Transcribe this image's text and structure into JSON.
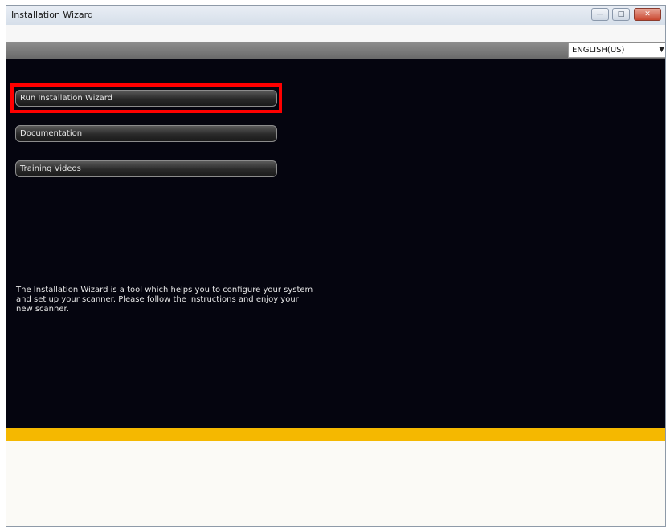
{
  "window": {
    "title": "Installation Wizard",
    "controls": {
      "minimize_glyph": "—",
      "maximize_glyph": "□",
      "close_glyph": "✕"
    }
  },
  "language": {
    "selected": "ENGLISH(US)",
    "arrow": "▼"
  },
  "menu": {
    "items": [
      {
        "label": "Run Installation Wizard"
      },
      {
        "label": "Documentation"
      },
      {
        "label": "Training Videos"
      }
    ]
  },
  "description": "The Installation Wizard is a tool which helps you to configure your system and set up your scanner. Please follow the instructions and enjoy your new scanner.",
  "colors": {
    "main_background": "#05050f",
    "accent_bar": "#f5b800",
    "highlight": "#ff0000"
  }
}
